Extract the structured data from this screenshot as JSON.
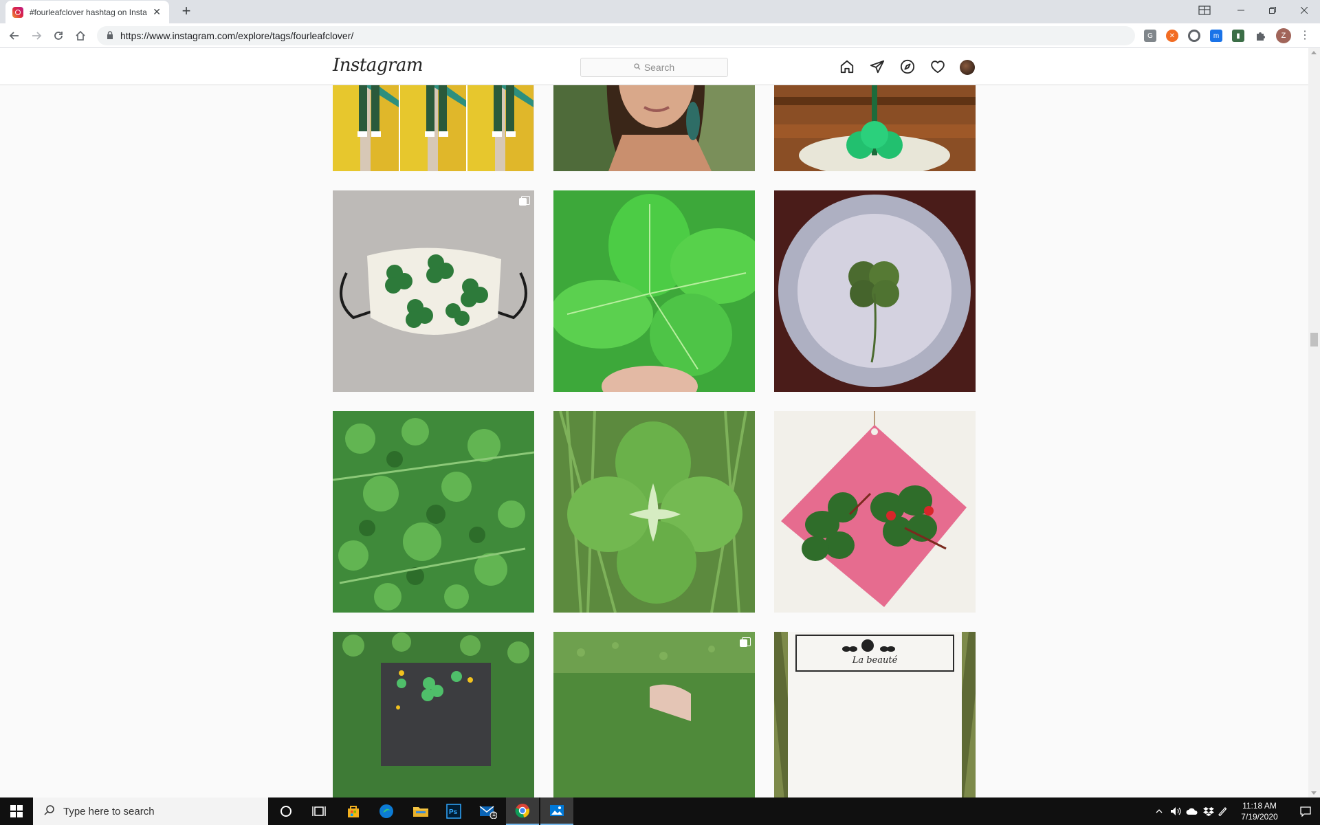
{
  "browser": {
    "tab_title": "#fourleafclover hashtag on Instagram",
    "tab_close": "✕",
    "new_tab": "+",
    "url": "https://www.instagram.com/explore/tags/fourleafclover/",
    "profile_initial": "Z",
    "extensions": [
      "grammarly-icon",
      "honey-icon",
      "extension-circle-icon",
      "extension-blue-icon",
      "extension-green-icon",
      "extensions-puzzle-icon"
    ]
  },
  "instagram": {
    "logo": "Instagram",
    "search_placeholder": "Search",
    "nav": [
      "home-icon",
      "direct-icon",
      "explore-icon",
      "activity-heart-icon",
      "profile-avatar"
    ]
  },
  "posts": [
    {
      "name": "post-man-yellow-flowers-triptych",
      "multi": false
    },
    {
      "name": "post-woman-straw-hat-selfie",
      "multi": false
    },
    {
      "name": "post-green-balloon-clover",
      "multi": false
    },
    {
      "name": "post-clover-face-mask",
      "multi": true
    },
    {
      "name": "post-four-leaf-clover-closeup",
      "multi": false
    },
    {
      "name": "post-pressed-clover-lamp",
      "multi": false
    },
    {
      "name": "post-clover-patch",
      "multi": false
    },
    {
      "name": "post-clover-in-grass",
      "multi": false
    },
    {
      "name": "post-felt-clover-ladybug-tag",
      "multi": false
    },
    {
      "name": "post-clover-painting",
      "multi": false
    },
    {
      "name": "post-hand-holding-clover",
      "multi": true
    },
    {
      "name": "post-la-beaute-card",
      "multi": false
    }
  ],
  "text_labels": {
    "la_beaute": "La beauté"
  },
  "taskbar": {
    "search_placeholder": "Type here to search",
    "time": "11:18 AM",
    "date": "7/19/2020",
    "mail_badge": "1"
  },
  "colors": {
    "ig_border": "#dbdbdb",
    "page_bg": "#fafafa",
    "taskbar_bg": "#101010",
    "chrome_tabstrip": "#dee1e6"
  }
}
